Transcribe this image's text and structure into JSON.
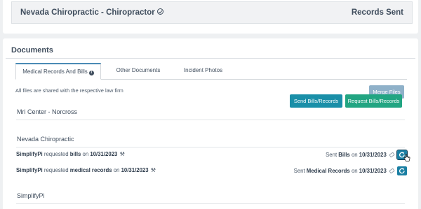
{
  "provider_row": {
    "name": "Nevada Chiropractic - Chiropractor",
    "status": "Records Sent"
  },
  "documents": {
    "title": "Documents",
    "tabs": [
      {
        "label": "Medical Records And Bills",
        "active": true
      },
      {
        "label": "Other Documents",
        "active": false
      },
      {
        "label": "Incident Photos",
        "active": false
      }
    ],
    "shared_note": "All files are shared with the respective law firm",
    "merge_label": "Merge Files",
    "sections": {
      "mri": {
        "name": "Mri Center - Norcross"
      },
      "nevada": {
        "name": "Nevada Chiropractic",
        "send_label": "Send Bills/Records",
        "request_label": "Request Bills/Records",
        "entries": [
          {
            "requester": "SimplifyPi",
            "requested_text": "requested",
            "item": "bills",
            "on_text": "on",
            "date": "10/31/2023",
            "sent_text": "Sent",
            "sent_item": "Bills",
            "sent_on": "on",
            "sent_date": "10/31/2023"
          },
          {
            "requester": "SimplifyPi",
            "requested_text": "requested",
            "item": "medical records",
            "on_text": "on",
            "date": "10/31/2023",
            "sent_text": "Sent",
            "sent_item": "Medical Records",
            "sent_on": "on",
            "sent_date": "10/31/2023"
          }
        ]
      },
      "simplifypi": {
        "name": "SimplifyPi"
      }
    }
  },
  "colors": {
    "teal_button": "#1a8fa8",
    "green_button": "#22a582",
    "merge_button": "#8fb1c9",
    "tab_accent": "#4a8bb5",
    "resend_button": "#1a7fa3"
  },
  "icons": {
    "verified": "check-circle-icon",
    "info": "info-icon",
    "wrench": "wrench-icon",
    "tag": "tag-icon",
    "resend": "resend-icon"
  }
}
